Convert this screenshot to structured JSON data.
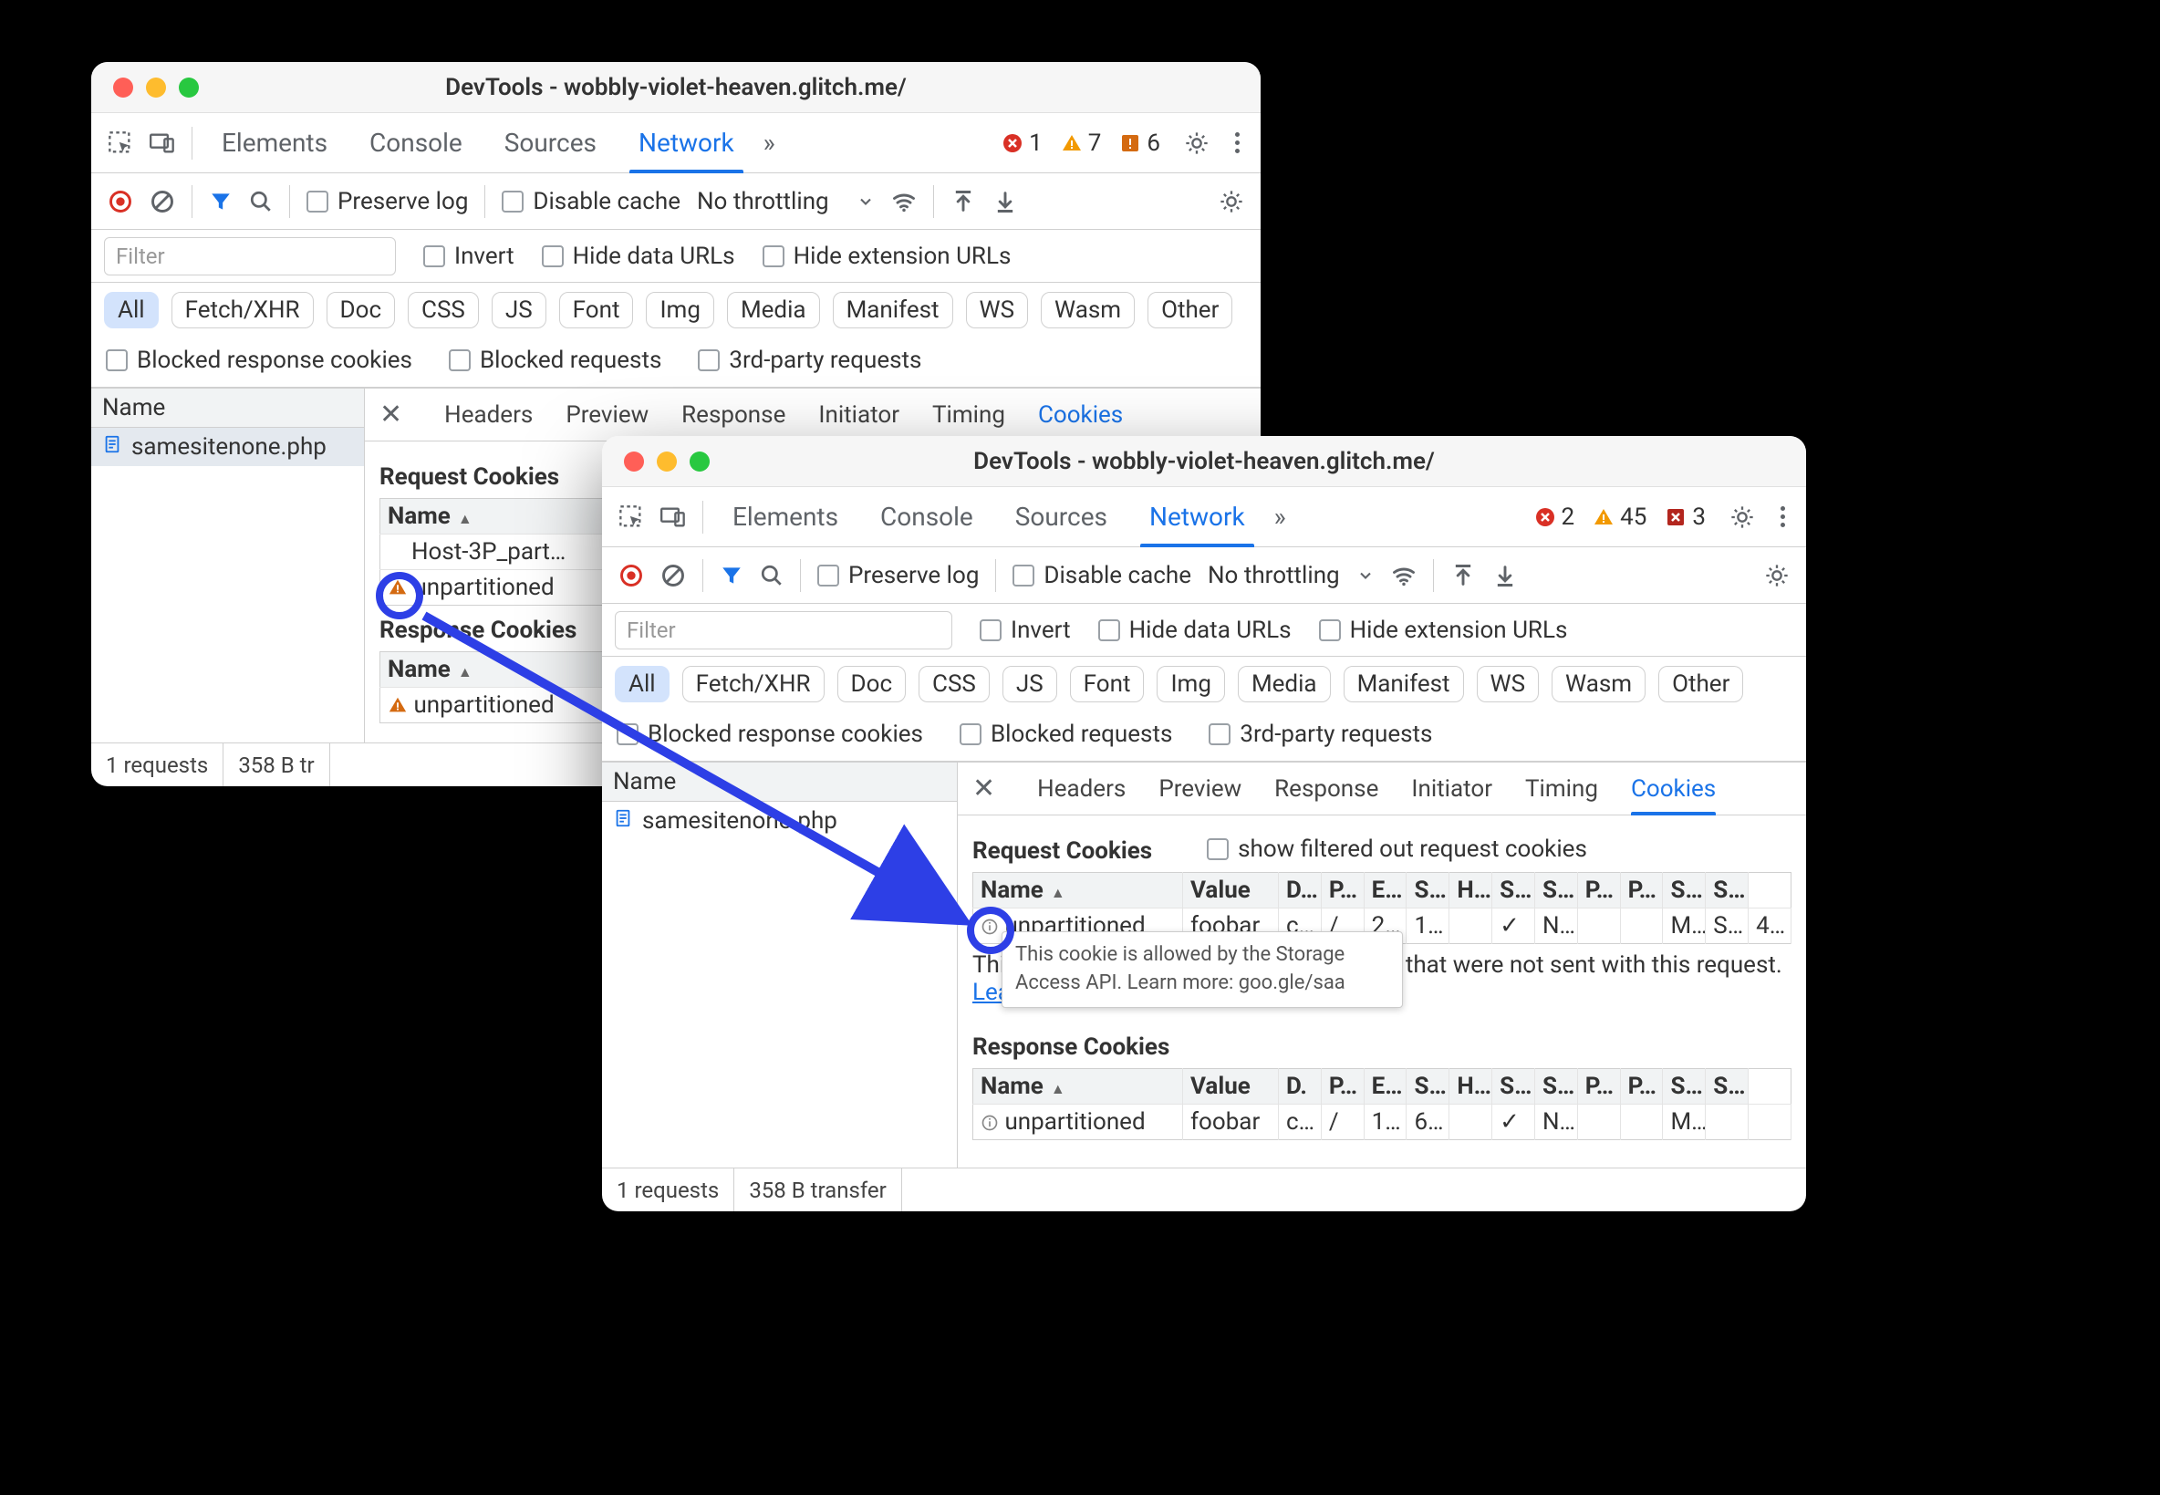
{
  "win1": {
    "title": "DevTools - wobbly-violet-heaven.glitch.me/",
    "tabs": [
      "Elements",
      "Console",
      "Sources",
      "Network"
    ],
    "activeTab": "Network",
    "issues": {
      "errors": "1",
      "warnings": "7",
      "infos": "6"
    },
    "toolbar": {
      "preserve": "Preserve log",
      "disable": "Disable cache",
      "throttling": "No throttling"
    },
    "filterPlaceholder": "Filter",
    "filterChecks": [
      "Invert",
      "Hide data URLs",
      "Hide extension URLs"
    ],
    "types": [
      "All",
      "Fetch/XHR",
      "Doc",
      "CSS",
      "JS",
      "Font",
      "Img",
      "Media",
      "Manifest",
      "WS",
      "Wasm",
      "Other"
    ],
    "bottomChecks": [
      "Blocked response cookies",
      "Blocked requests",
      "3rd-party requests"
    ],
    "leftHeader": "Name",
    "requests": [
      "samesitenone.php"
    ],
    "detailTabs": [
      "Headers",
      "Preview",
      "Response",
      "Initiator",
      "Timing",
      "Cookies"
    ],
    "activeDetail": "Cookies",
    "requestCookies": {
      "title": "Request Cookies",
      "nameCol": "Name",
      "rows": [
        {
          "name": "Host-3P_part…",
          "warn": false
        },
        {
          "name": "unpartitioned",
          "warn": true
        }
      ]
    },
    "responseCookies": {
      "title": "Response Cookies",
      "nameCol": "Name",
      "rows": [
        {
          "name": "unpartitioned",
          "warn": true
        }
      ]
    },
    "status": {
      "requests": "1 requests",
      "transfer": "358 B tr"
    }
  },
  "win2": {
    "title": "DevTools - wobbly-violet-heaven.glitch.me/",
    "tabs": [
      "Elements",
      "Console",
      "Sources",
      "Network"
    ],
    "activeTab": "Network",
    "issues": {
      "errors": "2",
      "warnings": "45",
      "infos": "3"
    },
    "toolbar": {
      "preserve": "Preserve log",
      "disable": "Disable cache",
      "throttling": "No throttling"
    },
    "filterPlaceholder": "Filter",
    "filterChecks": [
      "Invert",
      "Hide data URLs",
      "Hide extension URLs"
    ],
    "types": [
      "All",
      "Fetch/XHR",
      "Doc",
      "CSS",
      "JS",
      "Font",
      "Img",
      "Media",
      "Manifest",
      "WS",
      "Wasm",
      "Other"
    ],
    "bottomChecks": [
      "Blocked response cookies",
      "Blocked requests",
      "3rd-party requests"
    ],
    "leftHeader": "Name",
    "requests": [
      "samesitenone.php"
    ],
    "detailTabs": [
      "Headers",
      "Preview",
      "Response",
      "Initiator",
      "Timing",
      "Cookies"
    ],
    "activeDetail": "Cookies",
    "reqCookies": {
      "title": "Request Cookies",
      "showFiltered": "show filtered out request cookies",
      "cols": [
        "Name",
        "Value",
        "D…",
        "P…",
        "E…",
        "S…",
        "H…",
        "S…",
        "S…",
        "P…",
        "P…",
        "S…",
        "S…"
      ],
      "row": {
        "name": "unpartitioned",
        "value": "foobar",
        "cells": [
          "c…",
          "/",
          "2…",
          "1…",
          "",
          "✓",
          "N…",
          "",
          "",
          "M…",
          "S…",
          "4…"
        ]
      }
    },
    "note": {
      "pre": "Thi",
      "mid": "n, that were not sent with this request. ",
      "link": "Learn more"
    },
    "respCookies": {
      "title": "Response Cookies",
      "cols": [
        "Name",
        "Value",
        "D.",
        "P…",
        "E…",
        "S…",
        "H…",
        "S…",
        "S…",
        "P…",
        "P…",
        "S…",
        "S…"
      ],
      "row": {
        "name": "unpartitioned",
        "value": "foobar",
        "cells": [
          "c…",
          "/",
          "1…",
          "6…",
          "",
          "✓",
          "N…",
          "",
          "",
          "M…",
          "",
          ""
        ]
      }
    },
    "tooltip": "This cookie is allowed by the Storage Access API. Learn more: goo.gle/saa",
    "status": {
      "requests": "1 requests",
      "transfer": "358 B transfer"
    }
  }
}
